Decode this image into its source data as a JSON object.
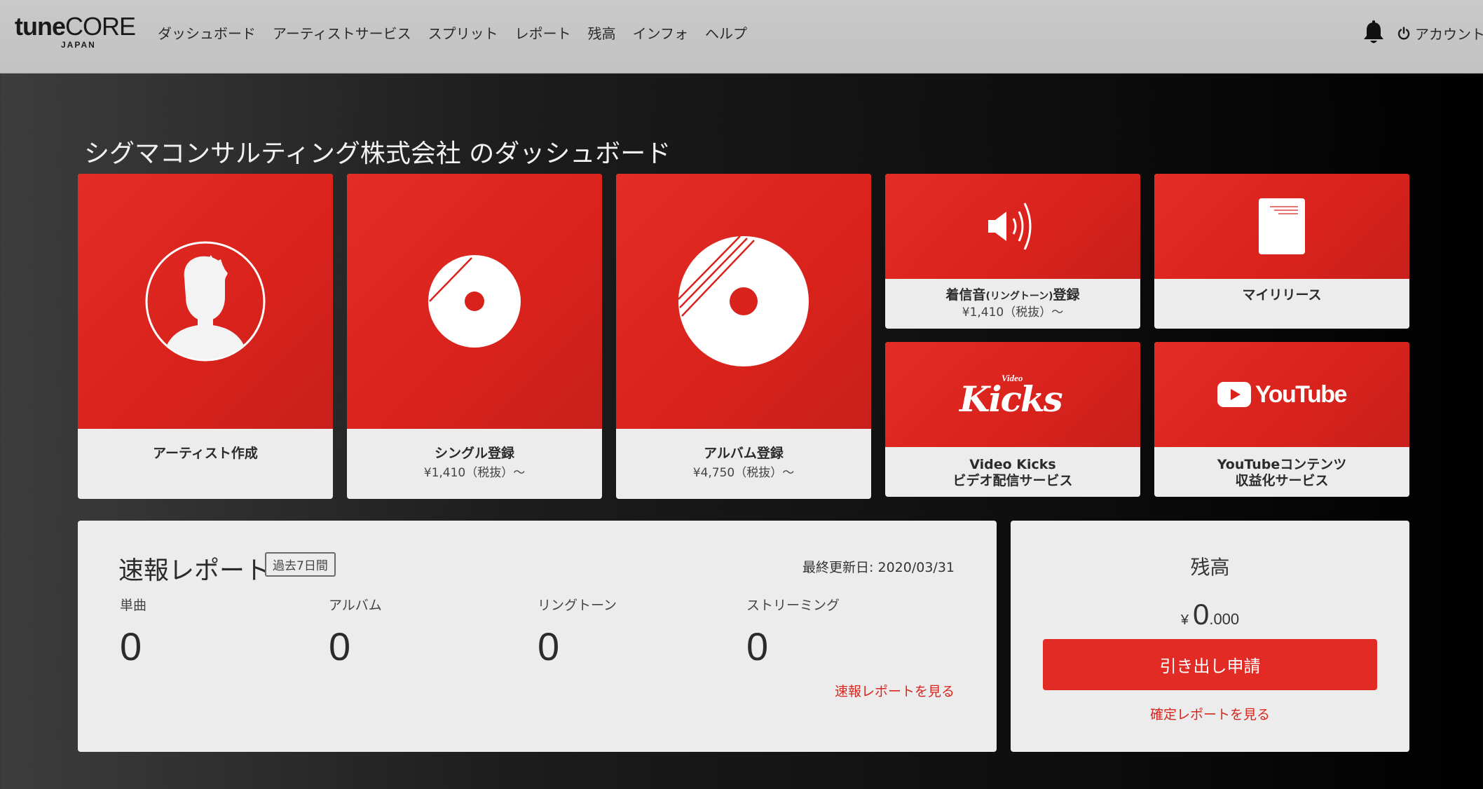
{
  "header": {
    "logo": {
      "main_bold": "tune",
      "main_light": "CORE",
      "sub": "JAPAN"
    },
    "nav": [
      {
        "label": "ダッシュボード"
      },
      {
        "label": "アーティストサービス"
      },
      {
        "label": "スプリット"
      },
      {
        "label": "レポート"
      },
      {
        "label": "残高"
      },
      {
        "label": "インフォ"
      },
      {
        "label": "ヘルプ"
      }
    ],
    "notification_icon": "bell-icon",
    "account_label": "アカウント",
    "account_icon": "power-icon"
  },
  "page_title": "シグマコンサルティング株式会社 のダッシュボード",
  "tiles": {
    "artist": {
      "label": "アーティスト作成",
      "icon": "artist-silhouette-icon"
    },
    "single": {
      "label": "シングル登録",
      "price": "¥1,410（税抜）～",
      "icon": "single-disc-icon"
    },
    "album": {
      "label": "アルバム登録",
      "price": "¥4,750（税抜）～",
      "icon": "album-disc-icon"
    },
    "ringtone": {
      "label_main": "着信音",
      "label_small": "(リングトーン)",
      "label_end": "登録",
      "price": "¥1,410（税抜）～",
      "icon": "speaker-icon"
    },
    "releases": {
      "label": "マイリリース",
      "icon": "document-icon"
    },
    "videokicks": {
      "logo_small": "Video",
      "logo_main": "Kicks",
      "label_line1": "Video Kicks",
      "label_line2": "ビデオ配信サービス"
    },
    "youtube": {
      "logo_text": "YouTube",
      "label_line1": "YouTubeコンテンツ",
      "label_line2": "収益化サービス"
    }
  },
  "report": {
    "title": "速報レポート",
    "period": "過去7日間",
    "updated": "最終更新日: 2020/03/31",
    "stats": [
      {
        "label": "単曲",
        "value": "0"
      },
      {
        "label": "アルバム",
        "value": "0"
      },
      {
        "label": "リングトーン",
        "value": "0"
      },
      {
        "label": "ストリーミング",
        "value": "0"
      }
    ],
    "link": "速報レポートを見る"
  },
  "balance": {
    "title": "残高",
    "currency": "¥",
    "amount_int": "0",
    "amount_dec": ".000",
    "button": "引き出し申請",
    "link": "確定レポートを見る"
  },
  "colors": {
    "accent_red": "#e12b24",
    "header_bg": "#c6c6c6",
    "tile_bg": "#ececec"
  }
}
